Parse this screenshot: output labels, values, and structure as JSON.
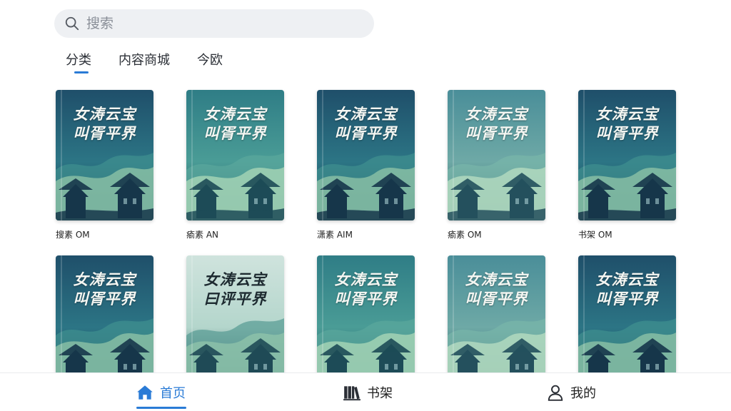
{
  "search": {
    "placeholder": "搜索"
  },
  "tabs": [
    {
      "label": "分类",
      "active": true
    },
    {
      "label": "内容商城",
      "active": false
    },
    {
      "label": "今欧",
      "active": false
    }
  ],
  "books": [
    {
      "title_line1": "女涛云宝",
      "title_line2": "叫胥平界",
      "name": "搜素 OM",
      "theme": "dark"
    },
    {
      "title_line1": "女涛云宝",
      "title_line2": "叫胥平界",
      "name": "瘉素 AN",
      "theme": "teal"
    },
    {
      "title_line1": "女涛云宝",
      "title_line2": "叫胥平界",
      "name": "潇素 AIM",
      "theme": "dark"
    },
    {
      "title_line1": "女涛云宝",
      "title_line2": "叫胥平界",
      "name": "瘉素 OM",
      "theme": "light"
    },
    {
      "title_line1": "女涛云宝",
      "title_line2": "叫胥平界",
      "name": "书架 OM",
      "theme": "dark"
    },
    {
      "title_line1": "女涛云宝",
      "title_line2": "叫胥平界",
      "name": "",
      "theme": "dark"
    },
    {
      "title_line1": "女涛云宝",
      "title_line2": "曰评平界",
      "name": "",
      "theme": "pale"
    },
    {
      "title_line1": "女涛云宝",
      "title_line2": "叫胥平界",
      "name": "",
      "theme": "teal"
    },
    {
      "title_line1": "女涛云宝",
      "title_line2": "叫胥平界",
      "name": "",
      "theme": "light"
    },
    {
      "title_line1": "女涛云宝",
      "title_line2": "叫胥平界",
      "name": "",
      "theme": "dark"
    }
  ],
  "nav": {
    "home": {
      "label": "首页",
      "icon": "home-icon",
      "active": true
    },
    "shelf": {
      "label": "书架",
      "icon": "bookshelf-icon",
      "active": false
    },
    "me": {
      "label": "我的",
      "icon": "user-icon",
      "active": false
    }
  },
  "colors": {
    "accent": "#2a7bd6"
  }
}
